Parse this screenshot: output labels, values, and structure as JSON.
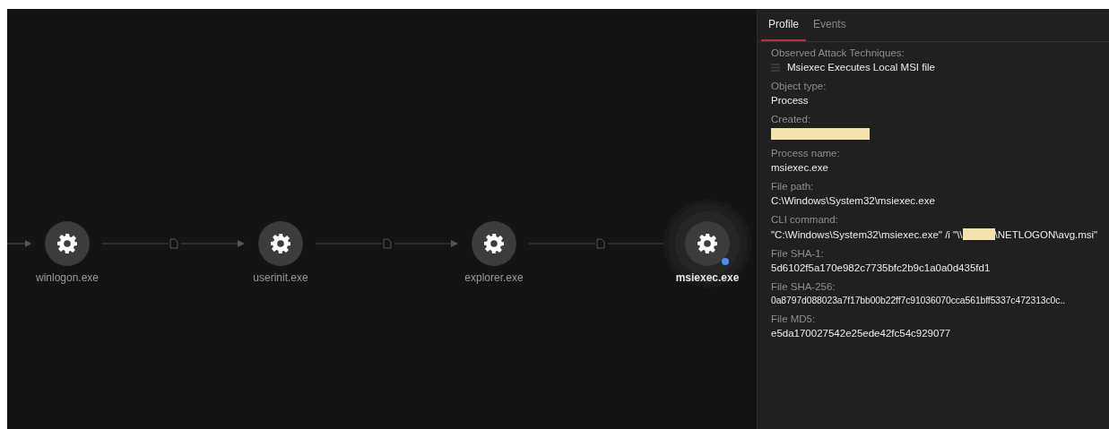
{
  "graph": {
    "nodes": [
      {
        "label": "winlogon.exe",
        "selected": false,
        "has_marker": false
      },
      {
        "label": "userinit.exe",
        "selected": false,
        "has_marker": false
      },
      {
        "label": "explorer.exe",
        "selected": false,
        "has_marker": false
      },
      {
        "label": "msiexec.exe",
        "selected": true,
        "has_marker": true
      }
    ]
  },
  "panel": {
    "tabs": [
      {
        "label": "Profile",
        "selected": true
      },
      {
        "label": "Events",
        "selected": false
      }
    ],
    "fields": [
      {
        "kind": "list",
        "label": "Observed Attack Techniques:",
        "items": [
          "Msiexec Executes Local MSI file"
        ]
      },
      {
        "kind": "text",
        "label": "Object type:",
        "value": "Process"
      },
      {
        "kind": "redacted",
        "label": "Created:"
      },
      {
        "kind": "text",
        "label": "Process name:",
        "value": "msiexec.exe"
      },
      {
        "kind": "text",
        "label": "File path:",
        "value": "C:\\Windows\\System32\\msiexec.exe"
      },
      {
        "kind": "split",
        "label": "CLI command:",
        "before": "\"C:\\Windows\\System32\\msiexec.exe\" /i \"\\\\",
        "after": "\\NETLOGON\\avg.msi\""
      },
      {
        "kind": "text",
        "label": "File SHA-1:",
        "value": "5d6102f5a170e982c7735bfc2b9c1a0a0d435fd1"
      },
      {
        "kind": "hash",
        "label": "File SHA-256:",
        "value": "0a8797d088023a7f17bb00b22ff7c91036070cca561bff5337c472313c0c.."
      },
      {
        "kind": "text",
        "label": "File MD5:",
        "value": "e5da170027542e25ede42fc54c929077"
      }
    ]
  }
}
